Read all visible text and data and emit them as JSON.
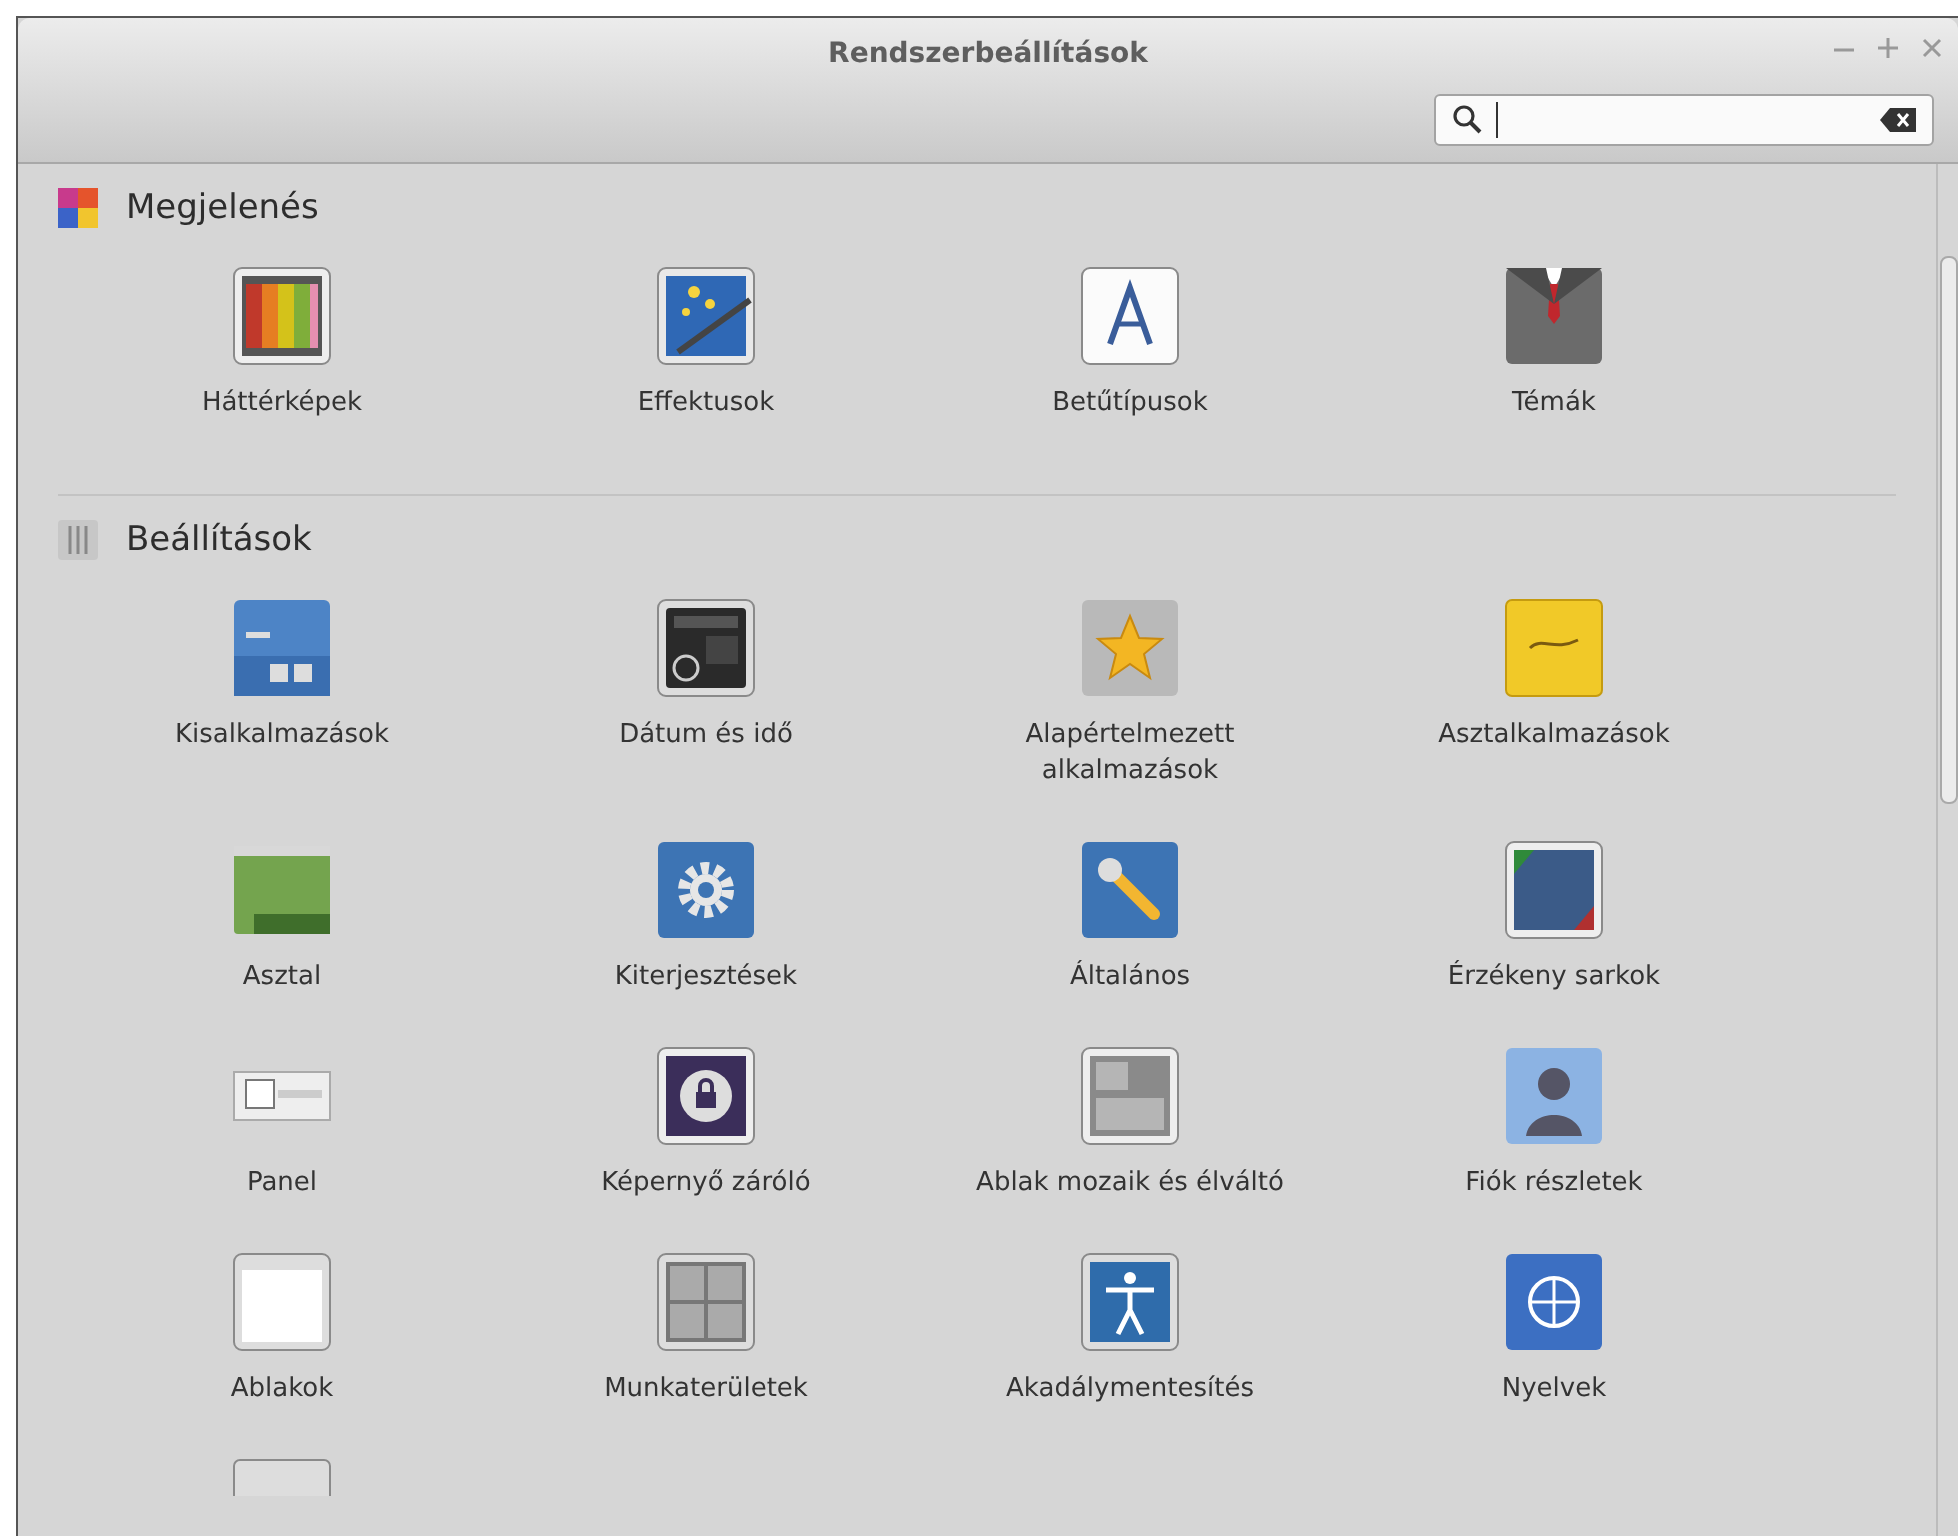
{
  "window": {
    "title": "Rendszerbeállítások"
  },
  "sections": [
    {
      "title": "Megjelenés",
      "items": [
        {
          "kind": "full",
          "label": "Háttérképek"
        },
        {
          "kind": "full",
          "label": "Effektusok"
        },
        {
          "kind": "full",
          "label": "Betűtípusok"
        },
        {
          "kind": "full",
          "label": "Témák"
        }
      ]
    },
    {
      "title": "Beállítások",
      "items": [
        {
          "kind": "full",
          "label": "Kisalkalmazások"
        },
        {
          "kind": "full",
          "label": "Dátum és idő"
        },
        {
          "kind": "full",
          "label": "Alapértelmezett alkalmazások"
        },
        {
          "kind": "full",
          "label": "Asztalkalmazások"
        },
        {
          "kind": "full",
          "label": "Asztal"
        },
        {
          "kind": "full",
          "label": "Kiterjesztések"
        },
        {
          "kind": "full",
          "label": "Általános"
        },
        {
          "kind": "full",
          "label": "Érzékeny sarkok"
        },
        {
          "kind": "full",
          "label": "Panel"
        },
        {
          "kind": "full",
          "label": "Képernyő záróló"
        },
        {
          "kind": "full",
          "label": "Ablak mozaik és élváltó"
        },
        {
          "kind": "full",
          "label": "Fiók részletek"
        },
        {
          "kind": "full",
          "label": "Ablakok"
        },
        {
          "kind": "full",
          "label": "Munkaterületek"
        },
        {
          "kind": "full",
          "label": "Akadálymentesítés"
        },
        {
          "kind": "full",
          "label": "Nyelvek"
        },
        {
          "kind": "cut"
        }
      ]
    }
  ]
}
